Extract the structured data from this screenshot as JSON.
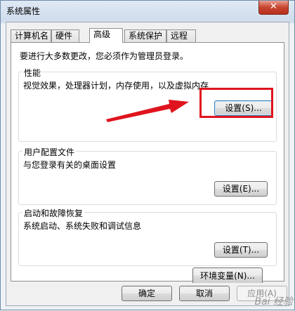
{
  "window": {
    "title": "系统属性",
    "close_label": "✕"
  },
  "tabs": [
    {
      "label": "计算机名",
      "active": false
    },
    {
      "label": "硬件",
      "active": false
    },
    {
      "label": "高级",
      "active": true
    },
    {
      "label": "系统保护",
      "active": false
    },
    {
      "label": "远程",
      "active": false
    }
  ],
  "advanced": {
    "admin_note": "要进行大多数更改，您必须作为管理员登录。",
    "performance": {
      "title": "性能",
      "description": "视觉效果，处理器计划，内存使用，以及虚拟内存",
      "button": "设置(S)..."
    },
    "user_profiles": {
      "title": "用户配置文件",
      "description": "与您登录有关的桌面设置",
      "button": "设置(E)..."
    },
    "startup_recovery": {
      "title": "启动和故障恢复",
      "description": "系统启动、系统失败和调试信息",
      "button": "设置(T)..."
    },
    "env_button": "环境变量(N)..."
  },
  "footer": {
    "ok": "确定",
    "cancel": "取消",
    "apply": "应用(A)"
  },
  "watermark": "Bai 经验",
  "colors": {
    "annotation_red": "#e0141e",
    "focus_blue": "#3c7fb1"
  }
}
